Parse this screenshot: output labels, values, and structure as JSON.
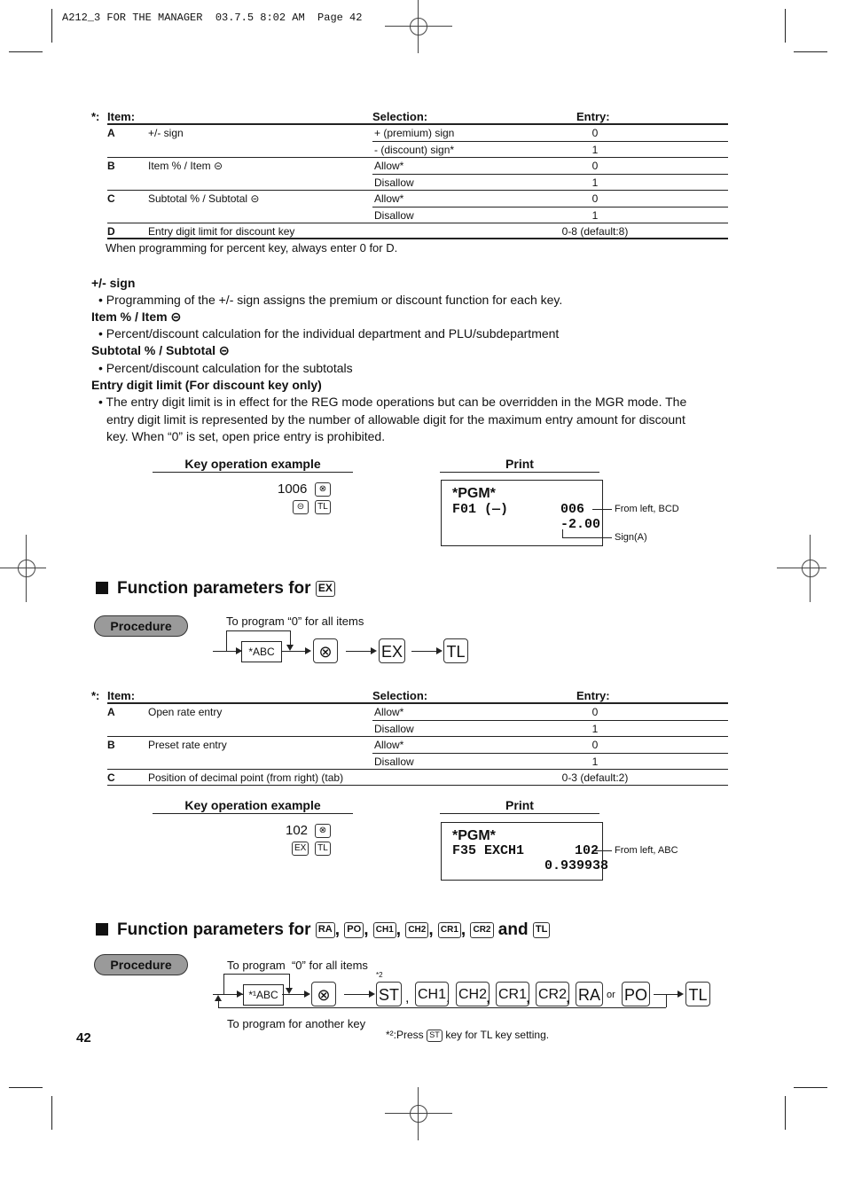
{
  "header": {
    "text": "A212_3 FOR THE MANAGER  03.7.5 8:02 AM  Page 42"
  },
  "table1": {
    "star": "*:",
    "col_item": "Item:",
    "col_selection": "Selection:",
    "col_entry": "Entry:",
    "rows": [
      {
        "letter": "A",
        "item": "+/- sign",
        "selection": "+ (premium) sign",
        "entry": "0"
      },
      {
        "letter": "",
        "item": "",
        "selection": "- (discount) sign*",
        "entry": "1"
      },
      {
        "letter": "B",
        "item": "Item % / Item ⊝",
        "selection": "Allow*",
        "entry": "0"
      },
      {
        "letter": "",
        "item": "",
        "selection": "Disallow",
        "entry": "1"
      },
      {
        "letter": "C",
        "item": "Subtotal % / Subtotal ⊝",
        "selection": "Allow*",
        "entry": "0"
      },
      {
        "letter": "",
        "item": "",
        "selection": "Disallow",
        "entry": "1"
      },
      {
        "letter": "D",
        "item": "Entry digit limit for discount key",
        "selection": "",
        "entry": "0-8 (default:8)"
      }
    ],
    "note": "When programming for percent key, always enter 0 for D."
  },
  "explanations": [
    {
      "title": "+/- sign",
      "lines": [
        "• Programming of the +/- sign assigns the premium or discount function for each key."
      ]
    },
    {
      "title": "Item % / Item ⊝",
      "lines": [
        "• Percent/discount calculation for the individual department and PLU/subdepartment"
      ]
    },
    {
      "title": "Subtotal % / Subtotal ⊝",
      "lines": [
        "• Percent/discount calculation for the subtotals"
      ]
    },
    {
      "title": "Entry digit limit (For discount key only)",
      "lines": [
        "• The entry digit limit is in effect for the REG mode operations but can be overridden in the MGR mode.  The",
        "entry digit limit is represented by the number of allowable digit for the maximum entry amount for discount",
        "key.  When “0” is set, open price entry is prohibited."
      ]
    }
  ],
  "example1": {
    "key_op_label": "Key operation example",
    "print_label": "Print",
    "entry": "1006",
    "key_times": "⊗",
    "key_minus": "⊝",
    "key_tl": "TL",
    "print_line1": "*PGM*",
    "print_line2_left": "F01 (—)",
    "print_line2_right": "006",
    "print_line3_right": "-2.00",
    "callout1": "From left, BCD",
    "callout2": "Sign(A)"
  },
  "section_ex": {
    "title": "Function parameters for",
    "key": "EX",
    "procedure": "Procedure",
    "loop_label": "To program “0” for all items",
    "abc": "*ABC",
    "k_times": "⊗",
    "k_ex": "EX",
    "k_tl": "TL"
  },
  "table2": {
    "star": "*:",
    "col_item": "Item:",
    "col_selection": "Selection:",
    "col_entry": "Entry:",
    "rows": [
      {
        "letter": "A",
        "item": "Open rate entry",
        "selection": "Allow*",
        "entry": "0"
      },
      {
        "letter": "",
        "item": "",
        "selection": "Disallow",
        "entry": "1"
      },
      {
        "letter": "B",
        "item": "Preset rate entry",
        "selection": "Allow*",
        "entry": "0"
      },
      {
        "letter": "",
        "item": "",
        "selection": "Disallow",
        "entry": "1"
      },
      {
        "letter": "C",
        "item": "Position of decimal point (from right) (tab)",
        "selection": "",
        "entry": "0-3 (default:2)"
      }
    ]
  },
  "example2": {
    "key_op_label": "Key operation example",
    "print_label": "Print",
    "entry": "102",
    "key_times": "⊗",
    "key_ex": "EX",
    "key_tl": "TL",
    "print_line1": "*PGM*",
    "print_line2_left": "F35 EXCH1",
    "print_line2_right": "102",
    "print_line3_right": "0.939938",
    "callout1": "From left, ABC"
  },
  "section_ra": {
    "title": "Function parameters for",
    "keys": [
      "RA",
      "PO",
      "CH1",
      "CH2",
      "CR1",
      "CR2"
    ],
    "and": "and",
    "last_key": "TL",
    "procedure": "Procedure",
    "loop_label": "To program  “0” for all items",
    "back_label": "To program for another key",
    "footnote_mark": "*2",
    "abc": "*¹ABC",
    "k_times": "⊗",
    "flow_keys": [
      "ST",
      "CH1",
      "CH2",
      "CR1",
      "CR2",
      "RA",
      "PO"
    ],
    "or": "or",
    "k_tl": "TL",
    "footnote_prefix": "*²:Press",
    "footnote_key": "ST",
    "footnote_suffix": "key for TL key setting."
  },
  "page_number": "42"
}
